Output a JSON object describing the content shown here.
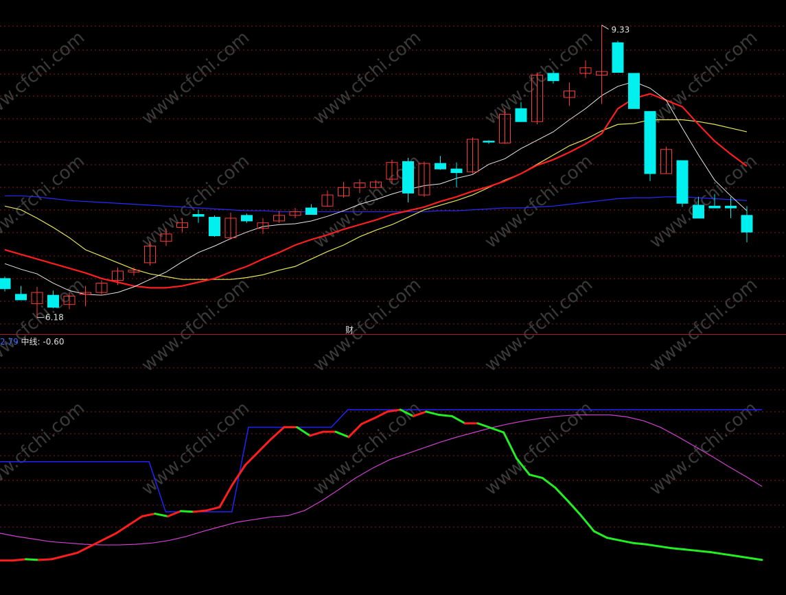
{
  "chart_data": [
    {
      "type": "candlestick",
      "annotations": {
        "high_label": "9.33",
        "low_label": "6.18"
      },
      "watermark": "www.cfchi.com",
      "colors": {
        "up": "#ff3b3b",
        "down": "#00f0f0",
        "ma_white": "#e8e8e8",
        "ma_red": "#ff1e1e",
        "ma_yellow": "#e6e65a",
        "ma_blue": "#2a2aff",
        "grid": "#8a1a1a"
      },
      "candles": [
        {
          "o": 6.6,
          "h": 6.62,
          "l": 6.46,
          "c": 6.49
        },
        {
          "o": 6.43,
          "h": 6.52,
          "l": 6.38,
          "c": 6.37
        },
        {
          "o": 6.33,
          "h": 6.51,
          "l": 6.18,
          "c": 6.45
        },
        {
          "o": 6.42,
          "h": 6.47,
          "l": 6.28,
          "c": 6.29
        },
        {
          "o": 6.32,
          "h": 6.45,
          "l": 6.27,
          "c": 6.41
        },
        {
          "o": 6.43,
          "h": 6.52,
          "l": 6.3,
          "c": 6.45
        },
        {
          "o": 6.45,
          "h": 6.58,
          "l": 6.42,
          "c": 6.55
        },
        {
          "o": 6.58,
          "h": 6.72,
          "l": 6.53,
          "c": 6.68
        },
        {
          "o": 6.67,
          "h": 6.72,
          "l": 6.63,
          "c": 6.69
        },
        {
          "o": 6.77,
          "h": 7.0,
          "l": 6.74,
          "c": 6.95
        },
        {
          "o": 7.0,
          "h": 7.14,
          "l": 6.95,
          "c": 7.08
        },
        {
          "o": 7.15,
          "h": 7.25,
          "l": 7.1,
          "c": 7.2
        },
        {
          "o": 7.29,
          "h": 7.34,
          "l": 7.2,
          "c": 7.27
        },
        {
          "o": 7.26,
          "h": 7.28,
          "l": 7.05,
          "c": 7.06
        },
        {
          "o": 7.04,
          "h": 7.31,
          "l": 7.02,
          "c": 7.25
        },
        {
          "o": 7.28,
          "h": 7.3,
          "l": 7.2,
          "c": 7.22
        },
        {
          "o": 7.14,
          "h": 7.25,
          "l": 7.08,
          "c": 7.2
        },
        {
          "o": 7.22,
          "h": 7.33,
          "l": 7.2,
          "c": 7.28
        },
        {
          "o": 7.28,
          "h": 7.36,
          "l": 7.25,
          "c": 7.32
        },
        {
          "o": 7.36,
          "h": 7.4,
          "l": 7.32,
          "c": 7.29
        },
        {
          "o": 7.38,
          "h": 7.55,
          "l": 7.38,
          "c": 7.5
        },
        {
          "o": 7.49,
          "h": 7.64,
          "l": 7.47,
          "c": 7.58
        },
        {
          "o": 7.58,
          "h": 7.67,
          "l": 7.52,
          "c": 7.63
        },
        {
          "o": 7.58,
          "h": 7.66,
          "l": 7.57,
          "c": 7.64
        },
        {
          "o": 7.67,
          "h": 7.88,
          "l": 7.62,
          "c": 7.85
        },
        {
          "o": 7.86,
          "h": 7.9,
          "l": 7.42,
          "c": 7.52
        },
        {
          "o": 7.5,
          "h": 7.86,
          "l": 7.48,
          "c": 7.84
        },
        {
          "o": 7.84,
          "h": 7.92,
          "l": 7.77,
          "c": 7.78
        },
        {
          "o": 7.78,
          "h": 7.85,
          "l": 7.58,
          "c": 7.74
        },
        {
          "o": 7.75,
          "h": 8.12,
          "l": 7.73,
          "c": 8.1
        },
        {
          "o": 8.08,
          "h": 8.09,
          "l": 8.05,
          "c": 8.07
        },
        {
          "o": 8.06,
          "h": 8.43,
          "l": 8.05,
          "c": 8.37
        },
        {
          "o": 8.43,
          "h": 8.5,
          "l": 8.33,
          "c": 8.29
        },
        {
          "o": 8.29,
          "h": 8.82,
          "l": 8.26,
          "c": 8.79
        },
        {
          "o": 8.81,
          "h": 8.83,
          "l": 8.7,
          "c": 8.73
        },
        {
          "o": 8.55,
          "h": 8.71,
          "l": 8.46,
          "c": 8.62
        },
        {
          "o": 8.81,
          "h": 8.95,
          "l": 8.76,
          "c": 8.87
        },
        {
          "o": 8.79,
          "h": 9.33,
          "l": 8.48,
          "c": 8.83
        },
        {
          "o": 9.14,
          "h": 9.16,
          "l": 8.83,
          "c": 8.82
        },
        {
          "o": 8.81,
          "h": 8.81,
          "l": 8.43,
          "c": 8.43
        },
        {
          "o": 8.4,
          "h": 8.4,
          "l": 7.65,
          "c": 7.73
        },
        {
          "o": 7.73,
          "h": 8.02,
          "l": 7.73,
          "c": 7.99
        },
        {
          "o": 7.87,
          "h": 7.87,
          "l": 7.37,
          "c": 7.41
        },
        {
          "o": 7.39,
          "h": 7.48,
          "l": 7.25,
          "c": 7.25
        },
        {
          "o": 7.38,
          "h": 7.51,
          "l": 7.38,
          "c": 7.36
        },
        {
          "o": 7.38,
          "h": 7.48,
          "l": 7.25,
          "c": 7.36
        },
        {
          "o": 7.28,
          "h": 7.38,
          "l": 6.99,
          "c": 7.1
        }
      ],
      "ma_white": [
        6.76,
        6.7,
        6.65,
        6.55,
        6.47,
        6.43,
        6.42,
        6.45,
        6.51,
        6.59,
        6.67,
        6.78,
        6.88,
        6.95,
        7.03,
        7.1,
        7.16,
        7.18,
        7.19,
        7.22,
        7.27,
        7.33,
        7.4,
        7.45,
        7.51,
        7.56,
        7.6,
        7.62,
        7.68,
        7.72,
        7.83,
        7.89,
        8.0,
        8.09,
        8.18,
        8.31,
        8.43,
        8.57,
        8.67,
        8.72,
        8.65,
        8.52,
        8.22,
        7.93,
        7.66,
        7.49,
        7.33
      ],
      "ma_red": [
        6.91,
        6.86,
        6.81,
        6.76,
        6.71,
        6.66,
        6.6,
        6.56,
        6.52,
        6.5,
        6.5,
        6.52,
        6.56,
        6.6,
        6.67,
        6.73,
        6.81,
        6.88,
        6.96,
        7.02,
        7.07,
        7.13,
        7.18,
        7.23,
        7.29,
        7.33,
        7.37,
        7.43,
        7.48,
        7.54,
        7.59,
        7.65,
        7.73,
        7.82,
        7.88,
        7.96,
        8.05,
        8.16,
        8.43,
        8.54,
        8.59,
        8.52,
        8.45,
        8.26,
        8.08,
        7.94,
        7.81
      ],
      "ma_yellow": [
        7.38,
        7.34,
        7.25,
        7.15,
        7.04,
        6.91,
        6.84,
        6.77,
        6.7,
        6.65,
        6.62,
        6.59,
        6.59,
        6.59,
        6.59,
        6.61,
        6.64,
        6.69,
        6.73,
        6.81,
        6.89,
        6.96,
        7.05,
        7.12,
        7.18,
        7.26,
        7.34,
        7.39,
        7.44,
        7.5,
        7.58,
        7.66,
        7.73,
        7.83,
        7.93,
        8.03,
        8.1,
        8.19,
        8.26,
        8.27,
        8.31,
        8.31,
        8.31,
        8.29,
        8.26,
        8.22,
        8.18
      ],
      "ma_blue": [
        7.49,
        7.49,
        7.48,
        7.46,
        7.44,
        7.43,
        7.42,
        7.41,
        7.4,
        7.39,
        7.38,
        7.37,
        7.36,
        7.35,
        7.34,
        7.33,
        7.33,
        7.32,
        7.32,
        7.32,
        7.32,
        7.32,
        7.32,
        7.32,
        7.32,
        7.32,
        7.32,
        7.33,
        7.33,
        7.34,
        7.35,
        7.36,
        7.36,
        7.37,
        7.38,
        7.4,
        7.42,
        7.44,
        7.46,
        7.47,
        7.47,
        7.48,
        7.48,
        7.47,
        7.46,
        7.45,
        7.44
      ],
      "ylim": [
        6.0,
        9.6
      ],
      "grid": true
    },
    {
      "type": "line",
      "title": "财",
      "legend": {
        "value1": "2.79",
        "label2": "中线:",
        "value2": "-0.60"
      },
      "colors": {
        "main_up": "#ff1e1e",
        "main_down": "#22ee22",
        "signal": "#d040d0",
        "ceiling": "#2222ff"
      },
      "ylim": [
        -0.5,
        3.5
      ],
      "main": [
        0.03,
        0.03,
        0.05,
        0.04,
        0.05,
        0.1,
        0.15,
        0.25,
        0.35,
        0.45,
        0.58,
        0.71,
        0.75,
        0.71,
        0.79,
        0.78,
        0.8,
        0.85,
        1.2,
        1.5,
        1.7,
        1.9,
        2.08,
        2.08,
        1.95,
        2.01,
        2.01,
        1.93,
        2.13,
        2.22,
        2.32,
        2.35,
        2.25,
        2.32,
        2.27,
        2.25,
        2.14,
        2.14,
        2.07,
        2.0,
        1.6,
        1.35,
        1.3,
        1.15,
        0.94,
        0.72,
        0.48,
        0.38,
        0.34,
        0.3,
        0.28,
        0.25,
        0.22,
        0.2,
        0.18,
        0.16,
        0.13,
        0.1,
        0.07,
        0.04
      ],
      "signal": [
        0.45,
        0.4,
        0.36,
        0.32,
        0.3,
        0.28,
        0.27,
        0.27,
        0.28,
        0.3,
        0.34,
        0.4,
        0.48,
        0.55,
        0.62,
        0.66,
        0.7,
        0.72,
        0.8,
        0.95,
        1.12,
        1.3,
        1.45,
        1.58,
        1.67,
        1.76,
        1.85,
        1.93,
        2.0,
        2.07,
        2.13,
        2.18,
        2.22,
        2.25,
        2.27,
        2.27,
        2.27,
        2.24,
        2.18,
        2.08,
        1.94,
        1.79,
        1.64,
        1.48,
        1.33,
        1.17
      ],
      "ceiling": [
        1.55,
        1.55,
        1.55,
        1.55,
        1.55,
        1.55,
        1.55,
        1.55,
        1.55,
        1.55,
        0.78,
        0.78,
        0.78,
        0.78,
        0.78,
        2.08,
        2.08,
        2.08,
        2.08,
        2.08,
        2.08,
        2.35,
        2.35,
        2.35,
        2.35,
        2.35,
        2.35,
        2.35,
        2.35,
        2.35,
        2.35,
        2.35,
        2.35,
        2.35,
        2.35,
        2.35,
        2.35,
        2.35,
        2.35,
        2.35,
        2.35,
        2.35,
        2.35,
        2.35,
        2.35,
        2.35,
        2.35
      ]
    }
  ]
}
